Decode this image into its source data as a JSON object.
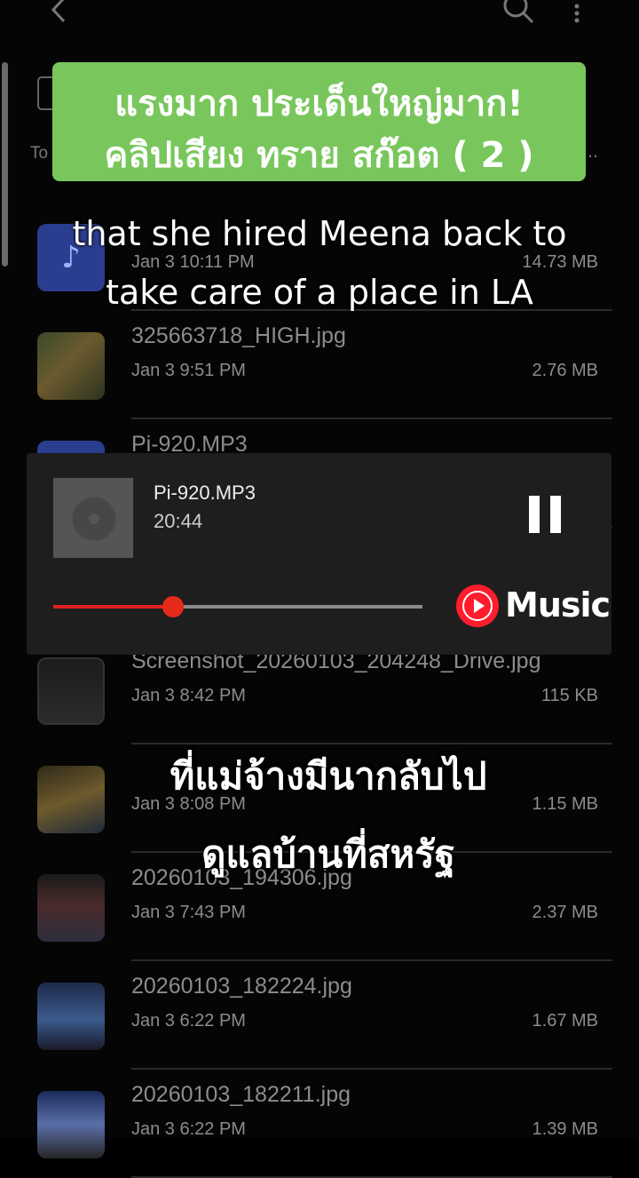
{
  "file_manager": {
    "sort_label": "To",
    "sort_extra": "..",
    "files": [
      {
        "name": "",
        "date": "Jan 3 10:11 PM",
        "size": "14.73 MB",
        "thumb": "audio",
        "icon": "music-note-icon",
        "glyph": "♪"
      },
      {
        "name": "325663718_HIGH.jpg",
        "date": "Jan 3 9:51 PM",
        "size": "2.76 MB",
        "thumb": "img1"
      },
      {
        "name": "Pi-920.MP3",
        "date": "",
        "size": "",
        "thumb": "audio",
        "icon": "audio-file-icon",
        "glyph": "D"
      },
      {
        "name": "Screenshot_20260103_204248_Drive.jpg",
        "date": "Jan 3 8:42 PM",
        "size": "115 KB",
        "thumb": "img2"
      },
      {
        "name": "",
        "date": "Jan 3 8:08 PM",
        "size": "1.15 MB",
        "thumb": "img3"
      },
      {
        "name": "20260103_194306.jpg",
        "date": "Jan 3 7:43 PM",
        "size": "2.37 MB",
        "thumb": "img4"
      },
      {
        "name": "20260103_182224.jpg",
        "date": "Jan 3 6:22 PM",
        "size": "1.67 MB",
        "thumb": "img5"
      },
      {
        "name": "20260103_182211.jpg",
        "date": "Jan 3 6:22 PM",
        "size": "1.39 MB",
        "thumb": "img6"
      }
    ]
  },
  "overlay": {
    "title_line1": "แรงมาก ประเด็นใหญ่มาก!",
    "title_line2": "คลิปเสียง ทราย สก๊อต ( 2 )",
    "subtitle_en": "that she hired Meena back to take care of a place in LA",
    "subtitle_th_line1": "ที่แม่จ้างมีนากลับไป",
    "subtitle_th_line2": "ดูแลบ้านที่สหรัฐ"
  },
  "player": {
    "track_name": "Pi-920.MP3",
    "track_time": "20:44",
    "progress_fraction": 0.325,
    "brand_label": "Music",
    "accent_color": "#e52a1c"
  }
}
